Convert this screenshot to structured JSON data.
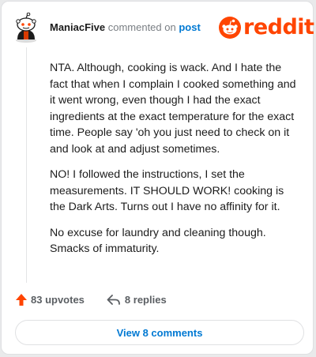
{
  "comment": {
    "username": "ManiacFive",
    "action_text": "commented on",
    "post_link": "post",
    "paragraphs": [
      "NTA. Although, cooking is wack. And I hate the fact that when I complain I cooked something and it went wrong, even though I had the exact ingredients at the exact temperature for the exact time. People say 'oh you just need to check on it and look at and adjust sometimes.",
      "NO! I followed the instructions, I set the measurements. IT SHOULD WORK! cooking is the Dark Arts. Turns out I have no affinity for it.",
      "No excuse for laundry and cleaning though. Smacks of immaturity."
    ]
  },
  "brand": {
    "name": "reddit",
    "icon": "snoo-icon",
    "color": "#ff4500"
  },
  "actions": {
    "upvotes_label": "83 upvotes",
    "upvote_icon": "upvote-arrow-icon",
    "upvote_color": "#ff4500",
    "replies_label": "8 replies",
    "reply_icon": "reply-arrow-icon"
  },
  "footer": {
    "view_comments_label": "View 8 comments",
    "link_color": "#0079d3"
  }
}
